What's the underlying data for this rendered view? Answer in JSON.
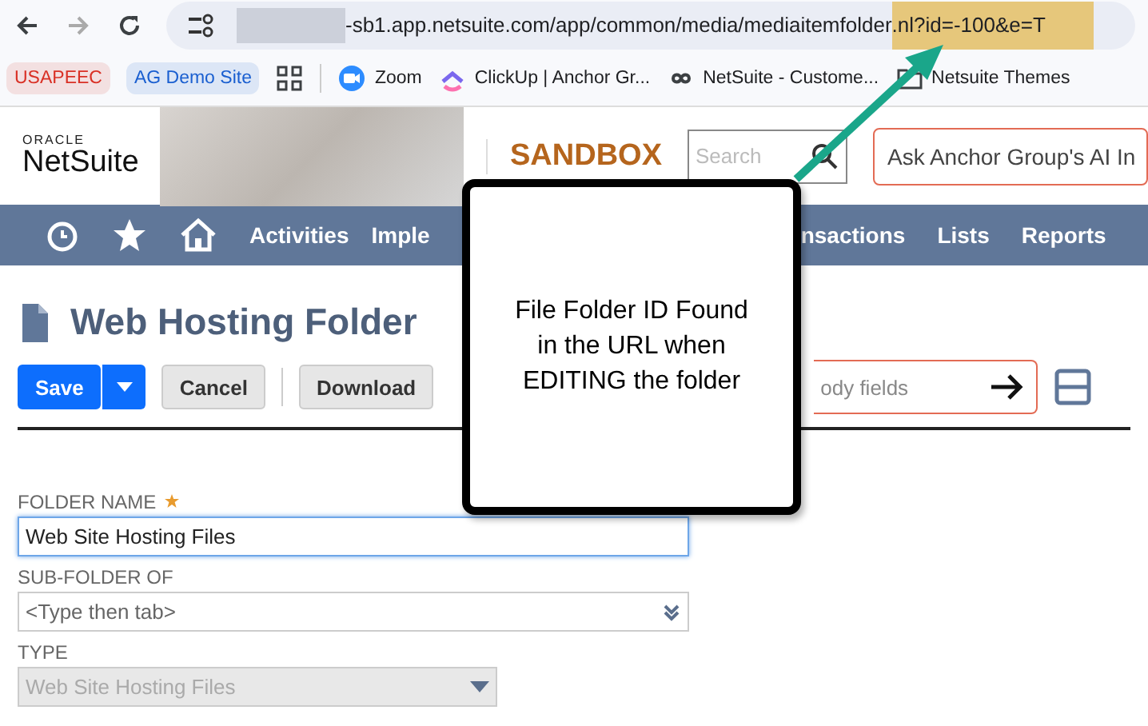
{
  "browser": {
    "url_parts": [
      {
        "text": "-sb1.app.netsuite.com/app/common/media/mediaitemfolder",
        "highlighted": false
      },
      {
        "text": ".nl?id=-100&e=T",
        "highlighted": true
      }
    ],
    "bookmarks": [
      {
        "kind": "chip",
        "label": "USAPEEC",
        "color": "#d93025"
      },
      {
        "kind": "chip",
        "label": "AG Demo Site",
        "color": "#1a5fd0"
      },
      {
        "kind": "apps"
      },
      {
        "kind": "link",
        "label": "Zoom"
      },
      {
        "kind": "link",
        "label": "ClickUp | Anchor Gr..."
      },
      {
        "kind": "link",
        "label": "NetSuite - Custome..."
      },
      {
        "kind": "link",
        "label": "Netsuite Themes"
      }
    ]
  },
  "header": {
    "logo_top": "ORACLE",
    "logo_main": "NetSuite",
    "environment": "SANDBOX",
    "search": {
      "placeholder": "Search"
    },
    "ai_search": {
      "placeholder": "Ask Anchor Group's AI In"
    }
  },
  "nav": {
    "items": [
      "Activities",
      "Imple",
      "nsactions",
      "Lists",
      "Reports"
    ]
  },
  "page": {
    "title": "Web Hosting Folder",
    "buttons": [
      {
        "kind": "primary",
        "label": "Save"
      },
      {
        "kind": "plain",
        "label": "Cancel"
      },
      {
        "kind": "plain",
        "label": "Download"
      }
    ],
    "field_search": {
      "placeholder": "ody fields"
    },
    "fields": [
      {
        "kind": "text",
        "label": "FOLDER NAME",
        "required": true,
        "value": "Web Site Hosting Files",
        "focused": true
      },
      {
        "kind": "select",
        "label": "SUB-FOLDER OF",
        "required": false,
        "placeholder": "<Type then tab>",
        "focused": false
      },
      {
        "kind": "dropdown",
        "label": "TYPE",
        "required": false,
        "value": "Web Site Hosting Files",
        "disabled": true,
        "focused": false
      }
    ]
  },
  "callout": {
    "text": "File Folder ID Found in the URL when EDITING the folder"
  }
}
